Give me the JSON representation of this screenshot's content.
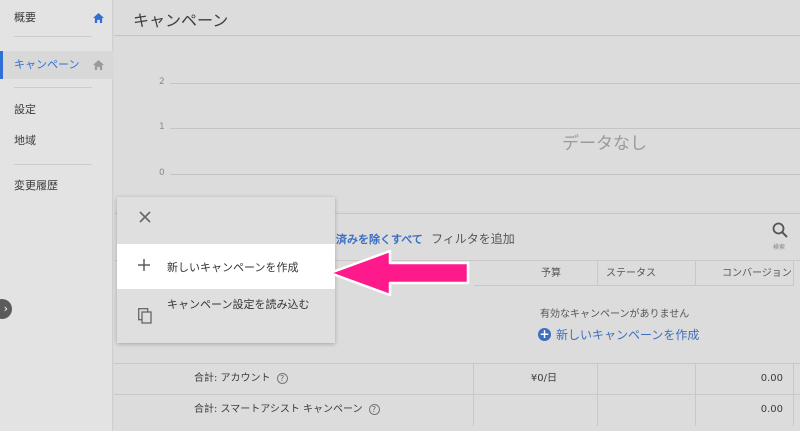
{
  "sidebar": {
    "items": [
      {
        "label": "概要"
      },
      {
        "label": "キャンペーン"
      },
      {
        "label": "設定"
      },
      {
        "label": "地域"
      },
      {
        "label": "変更履歴"
      }
    ],
    "collapse_glyph": "›"
  },
  "header": {
    "title": "キャンペーン"
  },
  "chart": {
    "y_ticks": [
      "2",
      "1",
      "0"
    ],
    "empty_text": "データなし"
  },
  "filter_bar": {
    "remove_filters_label": "済みを除くすべて",
    "add_filter_label": "フィルタを追加",
    "search_caption": "検索"
  },
  "table": {
    "columns": [
      "予算",
      "ステータス",
      "コンバージョン"
    ],
    "empty_message": "有効なキャンペーンがありません",
    "create_link": "新しいキャンペーンを作成",
    "rows": [
      {
        "label": "合計: アカウント",
        "budget": "¥0/日",
        "conversions": "0.00"
      },
      {
        "label": "合計: スマートアシスト キャンペーン",
        "budget": "",
        "conversions": "0.00"
      }
    ]
  },
  "popup": {
    "items": [
      {
        "label": "新しいキャンペーンを作成",
        "icon": "plus-icon"
      },
      {
        "label": "キャンペーン設定を読み込む",
        "icon": "copy-icon"
      }
    ]
  },
  "colors": {
    "accent": "#2f6fd6",
    "annotation_arrow": "#ff1a8c"
  }
}
